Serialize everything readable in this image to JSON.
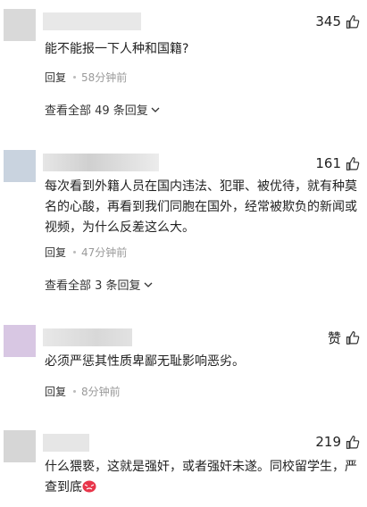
{
  "comments": [
    {
      "likes": "345",
      "text": "能不能报一下人种和国籍?",
      "reply_label": "回复",
      "time": "58分钟前",
      "more_replies": "查看全部 49 条回复",
      "avatar_color": "#d9d9d9"
    },
    {
      "likes": "161",
      "text": "每次看到外籍人员在国内违法、犯罪、被优待，就有种莫名的心酸，再看到我们同胞在国外，经常被欺负的新闻或视频，为什么反差这么大。",
      "reply_label": "回复",
      "time": "47分钟前",
      "more_replies": "查看全部 3 条回复",
      "avatar_color": "#c9d3df"
    },
    {
      "likes": "赞",
      "text": "必须严惩其性质卑鄙无耻影响恶劣。",
      "reply_label": "回复",
      "time": "8分钟前",
      "avatar_color": "#d8c7e3"
    },
    {
      "likes": "219",
      "text": "什么猥亵，这就是强奸，或者强奸未遂。同校留学生，严查到底",
      "reply_label": "",
      "time": "",
      "avatar_color": "#d6d6d6"
    }
  ]
}
